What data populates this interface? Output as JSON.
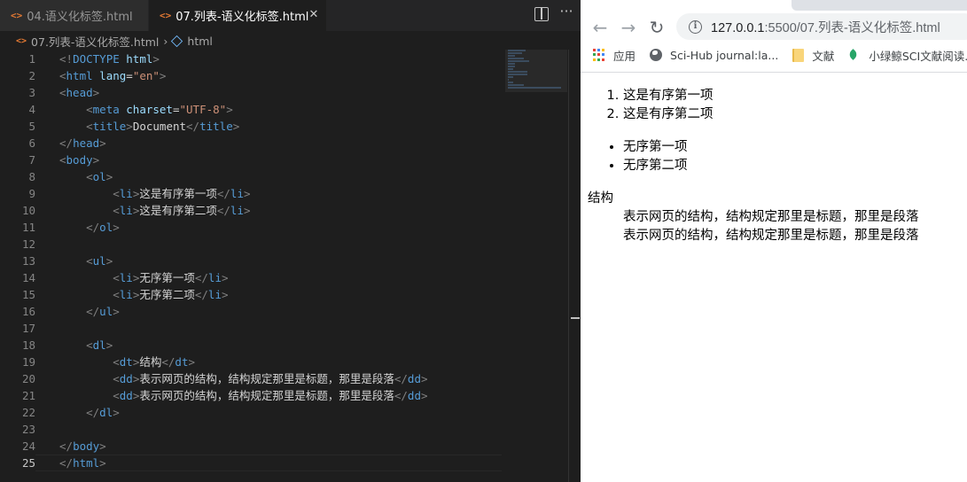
{
  "editor": {
    "tabs": [
      {
        "icon": "<>",
        "label": "04.语义化标签.html",
        "active": false
      },
      {
        "icon": "<>",
        "label": "07.列表-语义化标签.html",
        "active": true
      }
    ],
    "close_glyph": "✕",
    "more_glyph": "···",
    "breadcrumb": {
      "file": "07.列表-语义化标签.html",
      "separator": "›",
      "symbol": "html"
    },
    "line_numbers": [
      "1",
      "2",
      "3",
      "4",
      "5",
      "6",
      "7",
      "8",
      "9",
      "10",
      "11",
      "12",
      "13",
      "14",
      "15",
      "16",
      "17",
      "18",
      "19",
      "20",
      "21",
      "22",
      "23",
      "24",
      "25"
    ],
    "current_line": "25",
    "code": {
      "doctype_open": "<!",
      "doctype_kw": "DOCTYPE",
      "doctype_arg": "html",
      "doctype_close": ">",
      "html_tag": "html",
      "lang_attr": "lang",
      "lang_val": "\"en\"",
      "head_tag": "head",
      "meta_tag": "meta",
      "charset_attr": "charset",
      "charset_val": "\"UTF-8\"",
      "title_tag": "title",
      "title_text": "Document",
      "body_tag": "body",
      "ol_tag": "ol",
      "ul_tag": "ul",
      "li_tag": "li",
      "dl_tag": "dl",
      "dt_tag": "dt",
      "dd_tag": "dd",
      "li1": "这是有序第一项",
      "li2": "这是有序第二项",
      "li3": "无序第一项",
      "li4": "无序第二项",
      "dt_text": "结构",
      "dd1": "表示网页的结构，结构规定那里是标题，那里是段落",
      "dd2": "表示网页的结构，结构规定那里是标题，那里是段落"
    }
  },
  "browser": {
    "back_glyph": "←",
    "forward_glyph": "→",
    "reload_glyph": "↻",
    "info_glyph": "i",
    "url_host": "127.0.0.1",
    "url_rest": ":5500/07.列表-语义化标签.html",
    "bookmarks": [
      "应用",
      "Sci-Hub journal:la...",
      "文献",
      "小绿鲸SCI文献阅读..."
    ],
    "page": {
      "ordered": [
        "这是有序第一项",
        "这是有序第二项"
      ],
      "unordered": [
        "无序第一项",
        "无序第二项"
      ],
      "dt": "结构",
      "dd": [
        "表示网页的结构，结构规定那里是标题，那里是段落",
        "表示网页的结构，结构规定那里是标题，那里是段落"
      ]
    }
  }
}
